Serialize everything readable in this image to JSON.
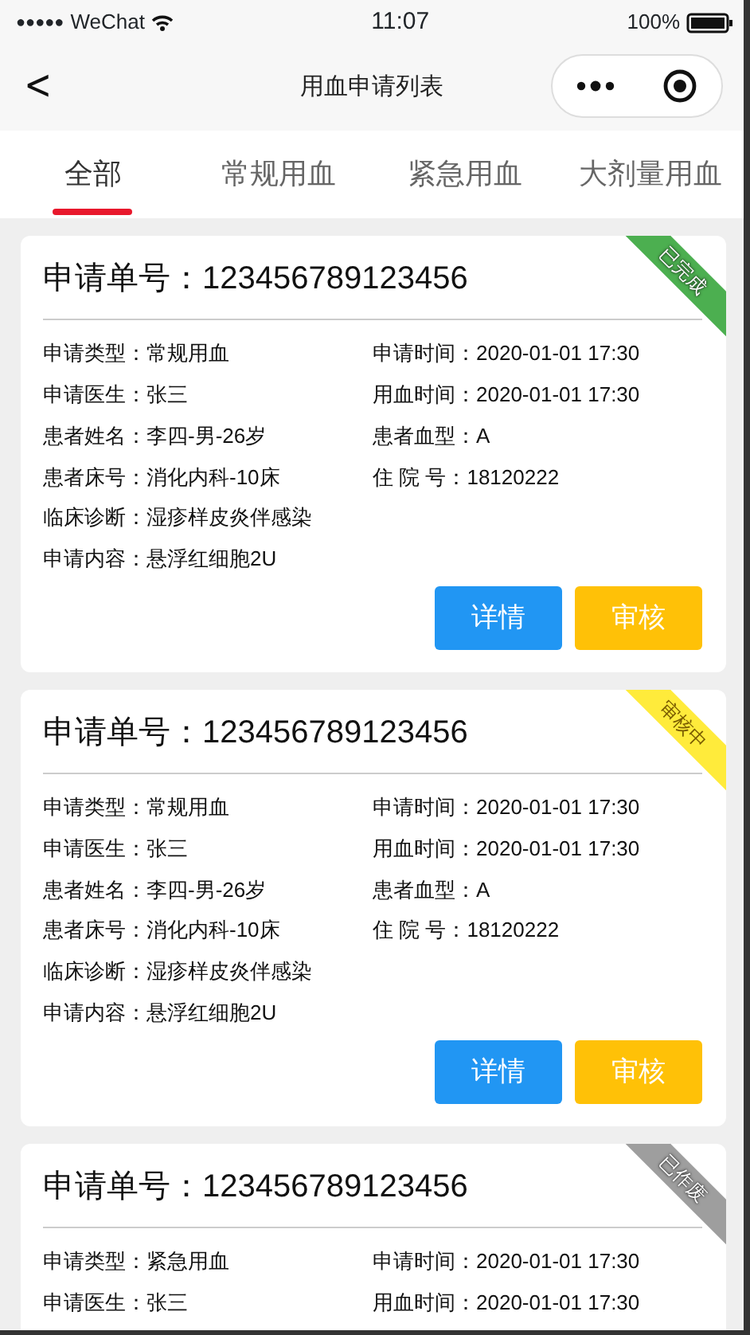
{
  "status_bar": {
    "signal": "●●●●●",
    "carrier": "WeChat",
    "time": "11:07",
    "battery": "100%"
  },
  "nav": {
    "back": "<",
    "title": "用血申请列表"
  },
  "tabs": [
    {
      "label": "全部",
      "selected": true
    },
    {
      "label": "常规用血",
      "selected": false
    },
    {
      "label": "紧急用血",
      "selected": false
    },
    {
      "label": "大剂量用血",
      "selected": false
    }
  ],
  "cards": [
    {
      "title": "申请单号：",
      "number": "123456789123456",
      "status": {
        "label": "已完成",
        "color": "#4caf50"
      },
      "rows": [
        [
          {
            "label": "申请类型：",
            "value": "常规用血"
          },
          {
            "label": "申请时间：",
            "value": "2020-01-01 17:30"
          }
        ],
        [
          {
            "label": "申请医生：",
            "value": "张三"
          },
          {
            "label": "用血时间：",
            "value": "2020-01-01 17:30"
          }
        ],
        [
          {
            "label": "患者姓名：",
            "value": "李四-男-26岁"
          },
          {
            "label": "患者血型：",
            "value": "A"
          }
        ],
        [
          {
            "label": "患者床号：",
            "value": "消化内科-10床"
          },
          {
            "label": "住 院 号：",
            "value": "18120222"
          }
        ],
        [
          {
            "label": "临床诊断：",
            "value": "湿疹样皮炎伴感染"
          }
        ],
        [
          {
            "label": "申请内容：",
            "value": "悬浮红细胞2U"
          }
        ]
      ],
      "buttons": [
        {
          "label": "详情",
          "kind": "detail"
        },
        {
          "label": "审核",
          "kind": "review"
        }
      ]
    },
    {
      "title": "申请单号：",
      "number": "123456789123456",
      "status": {
        "label": "审核中",
        "color": "#ffeb3b"
      },
      "rows": [
        [
          {
            "label": "申请类型：",
            "value": "常规用血"
          },
          {
            "label": "申请时间：",
            "value": "2020-01-01 17:30"
          }
        ],
        [
          {
            "label": "申请医生：",
            "value": "张三"
          },
          {
            "label": "用血时间：",
            "value": "2020-01-01 17:30"
          }
        ],
        [
          {
            "label": "患者姓名：",
            "value": "李四-男-26岁"
          },
          {
            "label": "患者血型：",
            "value": "A"
          }
        ],
        [
          {
            "label": "患者床号：",
            "value": "消化内科-10床"
          },
          {
            "label": "住 院 号：",
            "value": "18120222"
          }
        ],
        [
          {
            "label": "临床诊断：",
            "value": "湿疹样皮炎伴感染"
          }
        ],
        [
          {
            "label": "申请内容：",
            "value": "悬浮红细胞2U"
          }
        ]
      ],
      "buttons": [
        {
          "label": "详情",
          "kind": "detail"
        },
        {
          "label": "审核",
          "kind": "review"
        }
      ]
    },
    {
      "title": "申请单号：",
      "number": "123456789123456",
      "status": {
        "label": "已作废",
        "color": "#9e9e9e"
      },
      "rows": [
        [
          {
            "label": "申请类型：",
            "value": "紧急用血"
          },
          {
            "label": "申请时间：",
            "value": "2020-01-01 17:30"
          }
        ],
        [
          {
            "label": "申请医生：",
            "value": "张三"
          },
          {
            "label": "用血时间：",
            "value": "2020-01-01 17:30"
          }
        ]
      ]
    }
  ]
}
